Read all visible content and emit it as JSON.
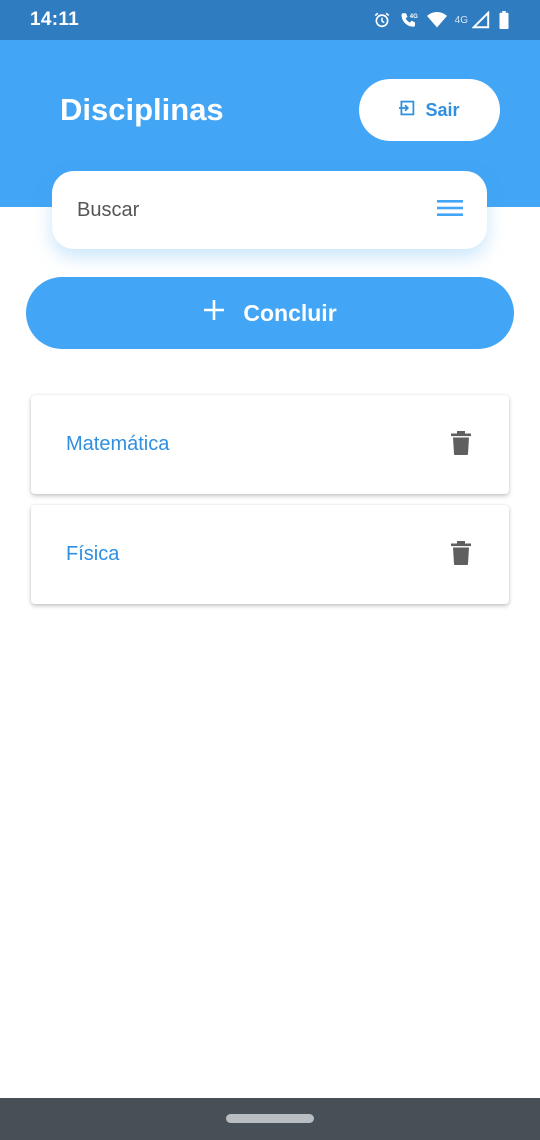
{
  "status_bar": {
    "time": "14:11",
    "network_label": "4G",
    "icons": [
      "alarm-icon",
      "wifi-calling-icon",
      "wifi-icon",
      "signal-icon",
      "battery-icon"
    ]
  },
  "header": {
    "title": "Disciplinas",
    "logout_label": "Sair",
    "background_color": "#42a5f5"
  },
  "search": {
    "placeholder": "Buscar"
  },
  "actions": {
    "conclude_label": "Concluir"
  },
  "subjects": [
    {
      "name": "Matemática"
    },
    {
      "name": "Física"
    }
  ],
  "colors": {
    "accent": "#42a5f5",
    "link_text": "#2f8fe0",
    "status_bar": "#2f7cc0",
    "nav_bar": "#474f57",
    "delete_icon": "#5f5f5f"
  }
}
